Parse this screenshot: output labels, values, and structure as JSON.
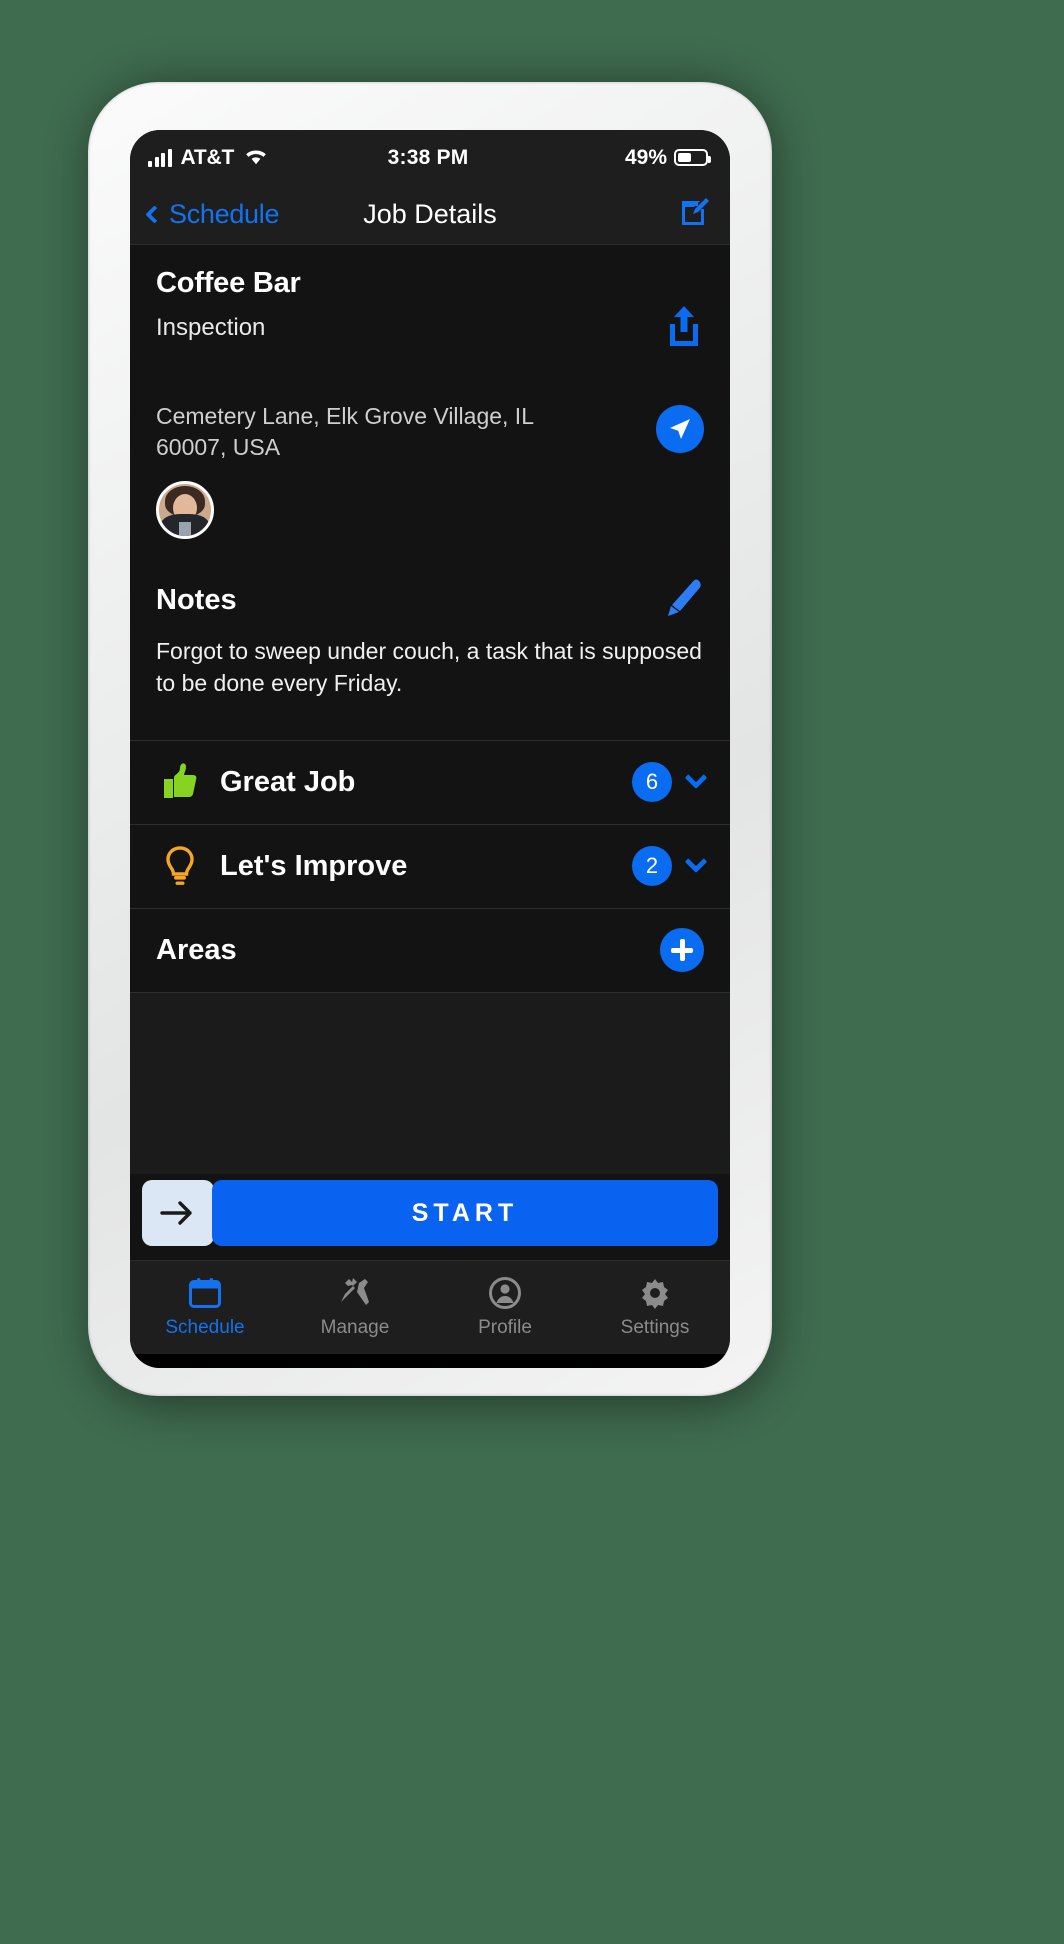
{
  "status_bar": {
    "carrier": "AT&T",
    "signal_icon": "cellular-bars-icon",
    "wifi_icon": "wifi-icon",
    "time": "3:38 PM",
    "battery_percent": "49%",
    "battery_level": 49
  },
  "nav_bar": {
    "back_label": "Schedule",
    "back_icon": "chevron-left-icon",
    "title": "Job Details",
    "edit_icon": "edit-square-icon"
  },
  "job": {
    "title": "Coffee Bar",
    "subtitle": "Inspection",
    "share_icon": "share-upload-icon",
    "address_line_1": "Cemetery Lane, Elk Grove Village, IL",
    "address_line_2": "60007, USA",
    "navigate_icon": "navigation-arrow-icon",
    "avatar_icon": "user-avatar"
  },
  "notes": {
    "title": "Notes",
    "edit_icon": "pencil-icon",
    "body": "Forgot to sweep under couch, a task that is supposed to be done every Friday."
  },
  "sections": [
    {
      "label": "Great Job",
      "icon": "thumbs-up-icon",
      "count": "6",
      "chevron_icon": "chevron-down-icon"
    },
    {
      "label": "Let's Improve",
      "icon": "lightbulb-icon",
      "count": "2",
      "chevron_icon": "chevron-down-icon"
    }
  ],
  "areas": {
    "label": "Areas",
    "add_icon": "plus-circle-icon"
  },
  "start_bar": {
    "arrow_icon": "arrow-right-icon",
    "label": "START"
  },
  "tab_bar": {
    "items": [
      {
        "label": "Schedule",
        "icon": "calendar-icon",
        "active": true
      },
      {
        "label": "Manage",
        "icon": "tools-icon",
        "active": false
      },
      {
        "label": "Profile",
        "icon": "person-circle-icon",
        "active": false
      },
      {
        "label": "Settings",
        "icon": "gear-icon",
        "active": false
      }
    ]
  },
  "android_nav": {
    "back_icon": "android-back-icon",
    "home_pill_icon": "home-pill-icon"
  },
  "colors": {
    "accent_blue": "#0a6cf1",
    "link_blue": "#1272ef",
    "great_job_green": "#86d321",
    "improve_yellow": "#f5a623",
    "screen_bg": "#131313",
    "bar_bg": "#1e1e1e"
  }
}
